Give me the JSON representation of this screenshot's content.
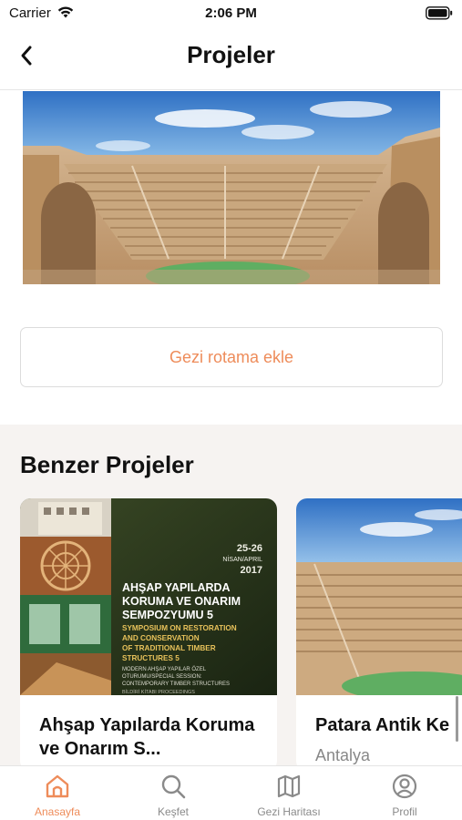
{
  "status_bar": {
    "carrier": "Carrier",
    "time": "2:06 PM"
  },
  "nav": {
    "title": "Projeler"
  },
  "actions": {
    "add_to_route": "Gezi rotama ekle"
  },
  "similar": {
    "title": "Benzer Projeler",
    "cards": [
      {
        "title": "Ahşap Yapılarda Koruma ve Onarım S...",
        "poster": {
          "date_days": "25-26",
          "date_month": "NİSAN/APRIL",
          "date_year": "2017",
          "heading_line1": "AHŞAP YAPILARDA",
          "heading_line2": "KORUMA VE ONARIM",
          "heading_line3": "SEMPOZYUMU 5",
          "english_line1": "SYMPOSIUM ON RESTORATION",
          "english_line2": "AND CONSERVATION",
          "english_line3": "OF TRADITIONAL TIMBER",
          "english_line4": "STRUCTURES 5",
          "session_line1": "MODERN AHŞAP YAPILAR ÖZEL",
          "session_line2": "OTURUMU/SPECIAL SESSION:",
          "session_line3": "CONTEMPORARY TIMBER STRUCTURES",
          "footer": "BİLDİRİ KİTABI PROCEEDINGS"
        }
      },
      {
        "title": "Patara Antik Ke",
        "subtitle": "Antalya"
      }
    ]
  },
  "tabs": [
    {
      "label": "Anasayfa",
      "icon": "home-icon",
      "active": true
    },
    {
      "label": "Keşfet",
      "icon": "search-icon",
      "active": false
    },
    {
      "label": "Gezi Haritası",
      "icon": "map-icon",
      "active": false
    },
    {
      "label": "Profil",
      "icon": "profile-icon",
      "active": false
    }
  ],
  "colors": {
    "accent": "#ee8c5a",
    "section_bg": "#f6f3f1",
    "inactive": "#8a8a8a"
  }
}
